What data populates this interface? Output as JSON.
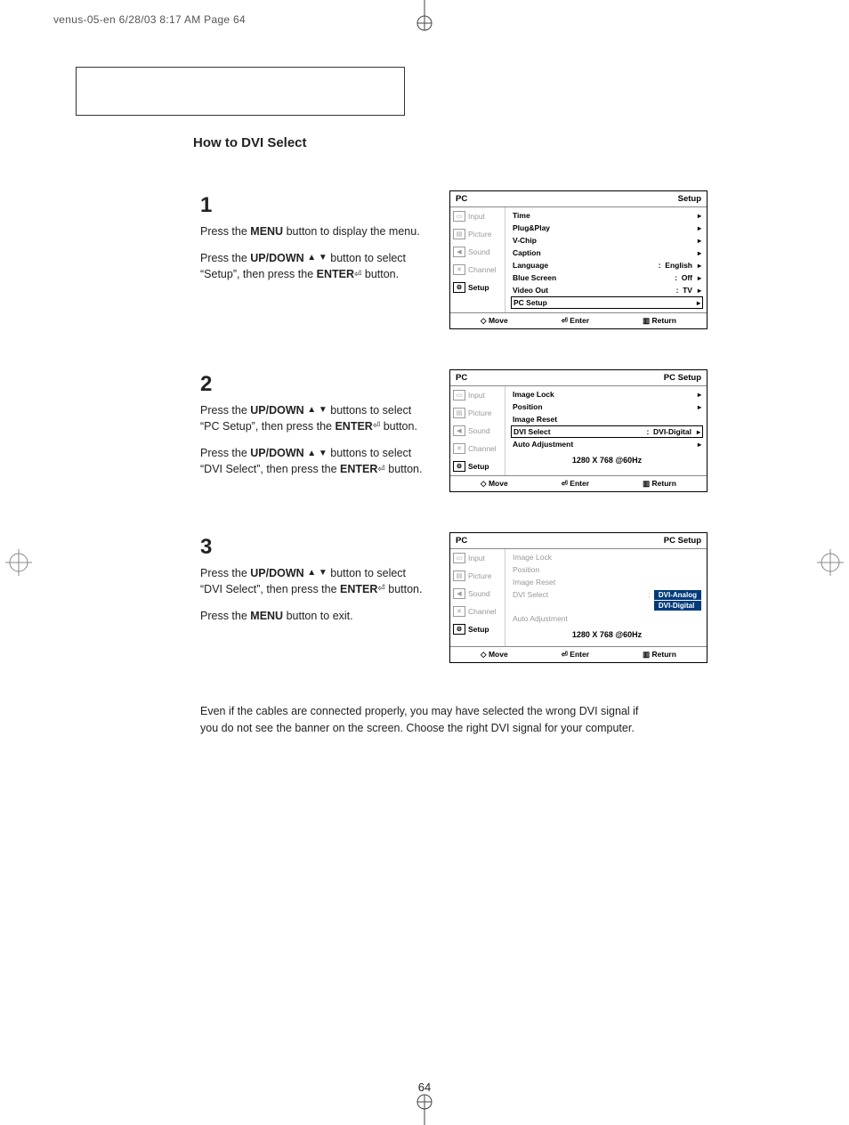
{
  "print_header": "venus-05-en  6/28/03 8:17 AM  Page 64",
  "section_title": "How to DVI Select",
  "page_number": "64",
  "steps": [
    {
      "num": "1",
      "paras": [
        "Press the <b>MENU</b> button to display the menu.",
        "Press the <b>UP/DOWN</b> <span class='arrow-icon'>▲ ▼</span> button to select “Setup”, then press the <b>ENTER</b><span class='enter-icon'>⏎</span> button."
      ]
    },
    {
      "num": "2",
      "paras": [
        "Press the <b>UP/DOWN</b> <span class='arrow-icon'>▲ ▼</span> buttons to select “PC Setup”, then press the <b>ENTER</b><span class='enter-icon'>⏎</span> button.",
        "Press the <b>UP/DOWN</b> <span class='arrow-icon'>▲ ▼</span> buttons to select “DVI Select”, then press the <b>ENTER</b><span class='enter-icon'>⏎</span> button."
      ]
    },
    {
      "num": "3",
      "paras": [
        "Press the <b>UP/DOWN</b> <span class='arrow-icon'>▲ ▼</span> button to select “DVI Select”, then press the <b>ENTER</b><span class='enter-icon'>⏎</span> button.",
        "Press the <b>MENU</b> button to exit."
      ]
    }
  ],
  "note": "Even if the cables are connected properly, you may have selected the wrong DVI signal if you do not see the banner on the screen. Choose the right DVI signal for your computer.",
  "osd_sidebar": [
    {
      "label": "Input",
      "icon": "▭"
    },
    {
      "label": "Picture",
      "icon": "▤"
    },
    {
      "label": "Sound",
      "icon": "◀"
    },
    {
      "label": "Channel",
      "icon": "✕"
    },
    {
      "label": "Setup",
      "icon": "⚙"
    }
  ],
  "osd_footer": {
    "move": "Move",
    "enter": "Enter",
    "return": "Return"
  },
  "osd1": {
    "left": "PC",
    "right": "Setup",
    "rows": [
      {
        "label": "Time",
        "val": ""
      },
      {
        "label": "Plug&Play",
        "val": ""
      },
      {
        "label": "V-Chip",
        "val": ""
      },
      {
        "label": "Caption",
        "val": ""
      },
      {
        "label": "Language",
        "val": "English"
      },
      {
        "label": "Blue Screen",
        "val": "Off"
      },
      {
        "label": "Video Out",
        "val": "TV"
      },
      {
        "label": "PC Setup",
        "val": "",
        "hl": true
      }
    ]
  },
  "osd2": {
    "left": "PC",
    "right": "PC Setup",
    "rows": [
      {
        "label": "Image Lock",
        "val": ""
      },
      {
        "label": "Position",
        "val": ""
      },
      {
        "label": "Image Reset",
        "val": "",
        "noarrow": true
      },
      {
        "label": "DVI Select",
        "val": "DVI-Digital",
        "hl": true
      },
      {
        "label": "Auto Adjustment",
        "val": ""
      }
    ],
    "res": "1280 X 768 @60Hz"
  },
  "osd3": {
    "left": "PC",
    "right": "PC Setup",
    "rows_top": [
      {
        "label": "Image Lock"
      },
      {
        "label": "Position"
      },
      {
        "label": "Image Reset"
      }
    ],
    "dvi_label": "DVI Select",
    "dvi_options": [
      "DVI-Analog",
      "DVI-Digital"
    ],
    "auto_label": "Auto Adjustment",
    "res": "1280 X 768 @60Hz"
  }
}
